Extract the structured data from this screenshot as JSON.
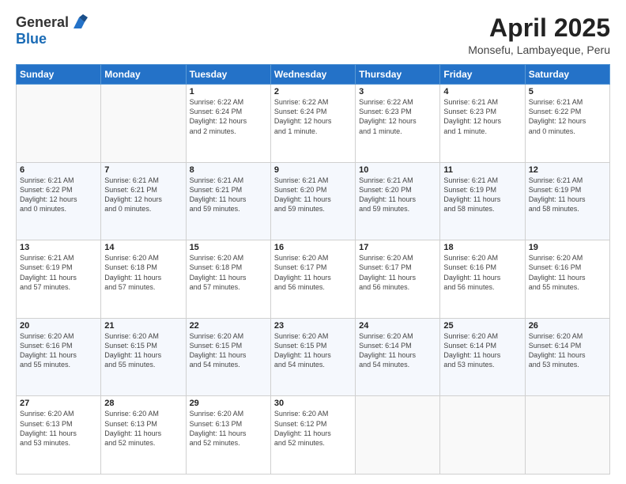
{
  "header": {
    "logo_general": "General",
    "logo_blue": "Blue",
    "month": "April 2025",
    "location": "Monsefu, Lambayeque, Peru"
  },
  "days_of_week": [
    "Sunday",
    "Monday",
    "Tuesday",
    "Wednesday",
    "Thursday",
    "Friday",
    "Saturday"
  ],
  "weeks": [
    [
      {
        "day": "",
        "detail": ""
      },
      {
        "day": "",
        "detail": ""
      },
      {
        "day": "1",
        "detail": "Sunrise: 6:22 AM\nSunset: 6:24 PM\nDaylight: 12 hours\nand 2 minutes."
      },
      {
        "day": "2",
        "detail": "Sunrise: 6:22 AM\nSunset: 6:24 PM\nDaylight: 12 hours\nand 1 minute."
      },
      {
        "day": "3",
        "detail": "Sunrise: 6:22 AM\nSunset: 6:23 PM\nDaylight: 12 hours\nand 1 minute."
      },
      {
        "day": "4",
        "detail": "Sunrise: 6:21 AM\nSunset: 6:23 PM\nDaylight: 12 hours\nand 1 minute."
      },
      {
        "day": "5",
        "detail": "Sunrise: 6:21 AM\nSunset: 6:22 PM\nDaylight: 12 hours\nand 0 minutes."
      }
    ],
    [
      {
        "day": "6",
        "detail": "Sunrise: 6:21 AM\nSunset: 6:22 PM\nDaylight: 12 hours\nand 0 minutes."
      },
      {
        "day": "7",
        "detail": "Sunrise: 6:21 AM\nSunset: 6:21 PM\nDaylight: 12 hours\nand 0 minutes."
      },
      {
        "day": "8",
        "detail": "Sunrise: 6:21 AM\nSunset: 6:21 PM\nDaylight: 11 hours\nand 59 minutes."
      },
      {
        "day": "9",
        "detail": "Sunrise: 6:21 AM\nSunset: 6:20 PM\nDaylight: 11 hours\nand 59 minutes."
      },
      {
        "day": "10",
        "detail": "Sunrise: 6:21 AM\nSunset: 6:20 PM\nDaylight: 11 hours\nand 59 minutes."
      },
      {
        "day": "11",
        "detail": "Sunrise: 6:21 AM\nSunset: 6:19 PM\nDaylight: 11 hours\nand 58 minutes."
      },
      {
        "day": "12",
        "detail": "Sunrise: 6:21 AM\nSunset: 6:19 PM\nDaylight: 11 hours\nand 58 minutes."
      }
    ],
    [
      {
        "day": "13",
        "detail": "Sunrise: 6:21 AM\nSunset: 6:19 PM\nDaylight: 11 hours\nand 57 minutes."
      },
      {
        "day": "14",
        "detail": "Sunrise: 6:20 AM\nSunset: 6:18 PM\nDaylight: 11 hours\nand 57 minutes."
      },
      {
        "day": "15",
        "detail": "Sunrise: 6:20 AM\nSunset: 6:18 PM\nDaylight: 11 hours\nand 57 minutes."
      },
      {
        "day": "16",
        "detail": "Sunrise: 6:20 AM\nSunset: 6:17 PM\nDaylight: 11 hours\nand 56 minutes."
      },
      {
        "day": "17",
        "detail": "Sunrise: 6:20 AM\nSunset: 6:17 PM\nDaylight: 11 hours\nand 56 minutes."
      },
      {
        "day": "18",
        "detail": "Sunrise: 6:20 AM\nSunset: 6:16 PM\nDaylight: 11 hours\nand 56 minutes."
      },
      {
        "day": "19",
        "detail": "Sunrise: 6:20 AM\nSunset: 6:16 PM\nDaylight: 11 hours\nand 55 minutes."
      }
    ],
    [
      {
        "day": "20",
        "detail": "Sunrise: 6:20 AM\nSunset: 6:16 PM\nDaylight: 11 hours\nand 55 minutes."
      },
      {
        "day": "21",
        "detail": "Sunrise: 6:20 AM\nSunset: 6:15 PM\nDaylight: 11 hours\nand 55 minutes."
      },
      {
        "day": "22",
        "detail": "Sunrise: 6:20 AM\nSunset: 6:15 PM\nDaylight: 11 hours\nand 54 minutes."
      },
      {
        "day": "23",
        "detail": "Sunrise: 6:20 AM\nSunset: 6:15 PM\nDaylight: 11 hours\nand 54 minutes."
      },
      {
        "day": "24",
        "detail": "Sunrise: 6:20 AM\nSunset: 6:14 PM\nDaylight: 11 hours\nand 54 minutes."
      },
      {
        "day": "25",
        "detail": "Sunrise: 6:20 AM\nSunset: 6:14 PM\nDaylight: 11 hours\nand 53 minutes."
      },
      {
        "day": "26",
        "detail": "Sunrise: 6:20 AM\nSunset: 6:14 PM\nDaylight: 11 hours\nand 53 minutes."
      }
    ],
    [
      {
        "day": "27",
        "detail": "Sunrise: 6:20 AM\nSunset: 6:13 PM\nDaylight: 11 hours\nand 53 minutes."
      },
      {
        "day": "28",
        "detail": "Sunrise: 6:20 AM\nSunset: 6:13 PM\nDaylight: 11 hours\nand 52 minutes."
      },
      {
        "day": "29",
        "detail": "Sunrise: 6:20 AM\nSunset: 6:13 PM\nDaylight: 11 hours\nand 52 minutes."
      },
      {
        "day": "30",
        "detail": "Sunrise: 6:20 AM\nSunset: 6:12 PM\nDaylight: 11 hours\nand 52 minutes."
      },
      {
        "day": "",
        "detail": ""
      },
      {
        "day": "",
        "detail": ""
      },
      {
        "day": "",
        "detail": ""
      }
    ]
  ]
}
